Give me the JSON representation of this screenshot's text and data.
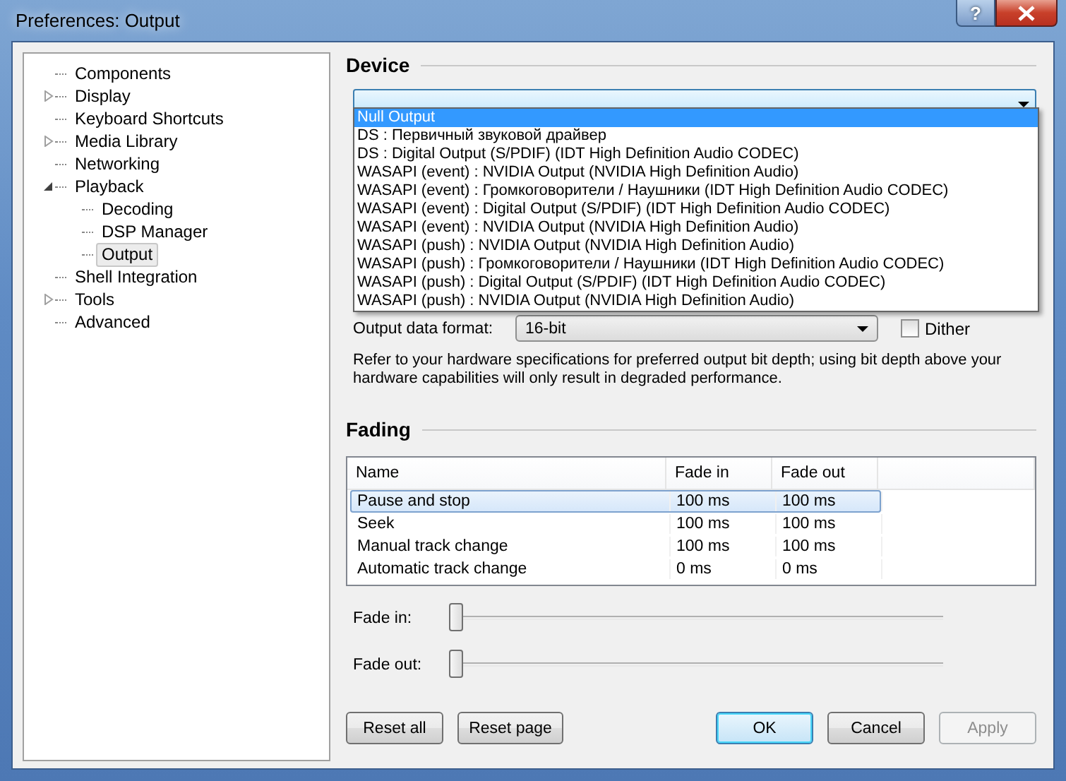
{
  "window": {
    "title": "Preferences: Output",
    "help_button": "?"
  },
  "tree": [
    {
      "label": "Components",
      "selected": false
    },
    {
      "label": "Display",
      "expanded": false,
      "selected": false
    },
    {
      "label": "Keyboard Shortcuts",
      "selected": false
    },
    {
      "label": "Media Library",
      "expanded": false,
      "selected": false
    },
    {
      "label": "Networking",
      "selected": false
    },
    {
      "label": "Playback",
      "expanded": true,
      "selected": false,
      "children": [
        {
          "label": "Decoding",
          "selected": false
        },
        {
          "label": "DSP Manager",
          "selected": false
        },
        {
          "label": "Output",
          "selected": true
        }
      ]
    },
    {
      "label": "Shell Integration",
      "selected": false
    },
    {
      "label": "Tools",
      "expanded": false,
      "selected": false
    },
    {
      "label": "Advanced",
      "selected": false
    }
  ],
  "device": {
    "heading": "Device",
    "open": true,
    "options": [
      {
        "label": "Null Output",
        "selected": true
      },
      {
        "label": "DS : Первичный звуковой драйвер",
        "selected": false
      },
      {
        "label": "DS : Digital Output (S/PDIF) (IDT High Definition Audio CODEC)",
        "selected": false
      },
      {
        "label": "WASAPI (event) : NVIDIA Output (NVIDIA High Definition Audio)",
        "selected": false
      },
      {
        "label": "WASAPI (event) : Громкоговорители / Наушники (IDT High Definition Audio CODEC)",
        "selected": false
      },
      {
        "label": "WASAPI (event) : Digital Output (S/PDIF) (IDT High Definition Audio CODEC)",
        "selected": false
      },
      {
        "label": "WASAPI (event) : NVIDIA Output (NVIDIA High Definition Audio)",
        "selected": false
      },
      {
        "label": "WASAPI (push) : NVIDIA Output (NVIDIA High Definition Audio)",
        "selected": false
      },
      {
        "label": "WASAPI (push) : Громкоговорители / Наушники (IDT High Definition Audio CODEC)",
        "selected": false
      },
      {
        "label": "WASAPI (push) : Digital Output (S/PDIF) (IDT High Definition Audio CODEC)",
        "selected": false
      },
      {
        "label": "WASAPI (push) : NVIDIA Output (NVIDIA High Definition Audio)",
        "selected": false
      }
    ]
  },
  "output_format": {
    "label": "Output data format:",
    "value": "16-bit",
    "dither": {
      "label": "Dither",
      "checked": false
    },
    "note": "Refer to your hardware specifications for preferred output bit depth; using bit depth above your hardware capabilities will only result in degraded performance."
  },
  "fading": {
    "heading": "Fading",
    "columns": [
      "Name",
      "Fade in",
      "Fade out"
    ],
    "rows": [
      {
        "cells": [
          "Pause and stop",
          "100 ms",
          "100 ms"
        ],
        "selected": true
      },
      {
        "cells": [
          "Seek",
          "100 ms",
          "100 ms"
        ],
        "selected": false
      },
      {
        "cells": [
          "Manual track change",
          "100 ms",
          "100 ms"
        ],
        "selected": false
      },
      {
        "cells": [
          "Automatic track change",
          "0 ms",
          "0 ms"
        ],
        "selected": false
      }
    ],
    "sliders": [
      {
        "label": "Fade in:",
        "level": 0
      },
      {
        "label": "Fade out:",
        "level": 0
      }
    ]
  },
  "buttons": [
    {
      "label": "Reset all",
      "default": false,
      "disabled": false
    },
    {
      "label": "Reset page",
      "default": false,
      "disabled": false
    },
    {
      "label": "OK",
      "default": true,
      "disabled": false
    },
    {
      "label": "Cancel",
      "default": false,
      "disabled": false
    },
    {
      "label": "Apply",
      "default": false,
      "disabled": true
    }
  ]
}
